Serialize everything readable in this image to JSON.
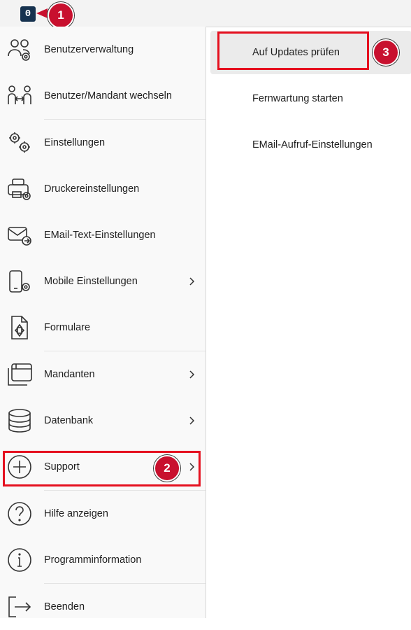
{
  "topbar": {
    "app_button_glyph": "0"
  },
  "menu": {
    "items": [
      {
        "label": "Benutzerverwaltung",
        "icon": "users-gear-icon"
      },
      {
        "label": "Benutzer/Mandant wechseln",
        "icon": "switch-user-icon"
      },
      {
        "label": "Einstellungen",
        "icon": "gears-icon"
      },
      {
        "label": "Druckereinstellungen",
        "icon": "printer-gear-icon"
      },
      {
        "label": "EMail-Text-Einstellungen",
        "icon": "mail-arrow-icon"
      },
      {
        "label": "Mobile Einstellungen",
        "icon": "mobile-gear-icon",
        "has_submenu": true
      },
      {
        "label": "Formulare",
        "icon": "form-document-icon"
      },
      {
        "label": "Mandanten",
        "icon": "windows-stack-icon",
        "has_submenu": true
      },
      {
        "label": "Datenbank",
        "icon": "database-icon",
        "has_submenu": true
      },
      {
        "label": "Support",
        "icon": "plus-circle-icon",
        "has_submenu": true
      },
      {
        "label": "Hilfe anzeigen",
        "icon": "question-circle-icon"
      },
      {
        "label": "Programminformation",
        "icon": "info-circle-icon"
      },
      {
        "label": "Beenden",
        "icon": "exit-arrow-icon"
      }
    ]
  },
  "submenu": {
    "items": [
      {
        "label": "Auf Updates prüfen"
      },
      {
        "label": "Fernwartung starten"
      },
      {
        "label": "EMail-Aufruf-Einstellungen"
      }
    ]
  },
  "annotations": {
    "badge1": "1",
    "badge2": "2",
    "badge3": "3"
  },
  "colors": {
    "highlight": "#e5101f",
    "badge": "#c8102e",
    "app_button": "#16324f"
  }
}
